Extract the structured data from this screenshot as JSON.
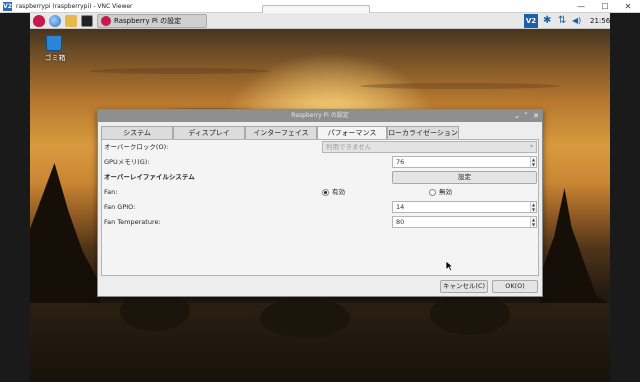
{
  "vnc_window": {
    "title": "raspberrypi (raspberrypi) - VNC Viewer",
    "app_icon_text": "V2",
    "minimize_glyph": "—",
    "maximize_glyph": "☐",
    "close_glyph": "✕"
  },
  "taskbar": {
    "launchers": [
      "raspberry-menu-icon",
      "web-browser-icon",
      "file-manager-icon",
      "terminal-icon"
    ],
    "active_task_label": "Raspberry Pi の設定",
    "tray": {
      "vnc_text": "V2",
      "bluetooth_glyph": "✱",
      "network_glyph": "⇅",
      "volume_glyph": "◀)",
      "clock": "21:56"
    }
  },
  "desktop": {
    "trash_label": "ゴミ箱"
  },
  "dialog": {
    "title": "Raspberry Pi の設定",
    "controls": {
      "minimize": "⌄",
      "maximize": "˄",
      "close": "✕"
    },
    "tabs": [
      {
        "label": "システム",
        "active": false
      },
      {
        "label": "ディスプレイ",
        "active": false
      },
      {
        "label": "インターフェイス",
        "active": false
      },
      {
        "label": "パフォーマンス",
        "active": true
      },
      {
        "label": "ローカライゼーション",
        "active": false
      }
    ],
    "performance": {
      "overclock": {
        "label": "オーバークロック(O):",
        "value": "利用できません",
        "disabled": true
      },
      "gpu_memory": {
        "label": "GPUメモリ(G):",
        "value": "76"
      },
      "overlay_fs": {
        "label": "オーバーレイファイルシステム",
        "button_label": "設定"
      },
      "fan": {
        "label": "Fan:",
        "enabled_label": "有効",
        "disabled_label": "無効",
        "selected": "有効"
      },
      "fan_gpio": {
        "label": "Fan GPIO:",
        "value": "14"
      },
      "fan_temperature": {
        "label": "Fan Temperature:",
        "value": "80"
      }
    },
    "buttons": {
      "cancel": "キャンセル(C)",
      "ok": "OK(O)"
    }
  }
}
